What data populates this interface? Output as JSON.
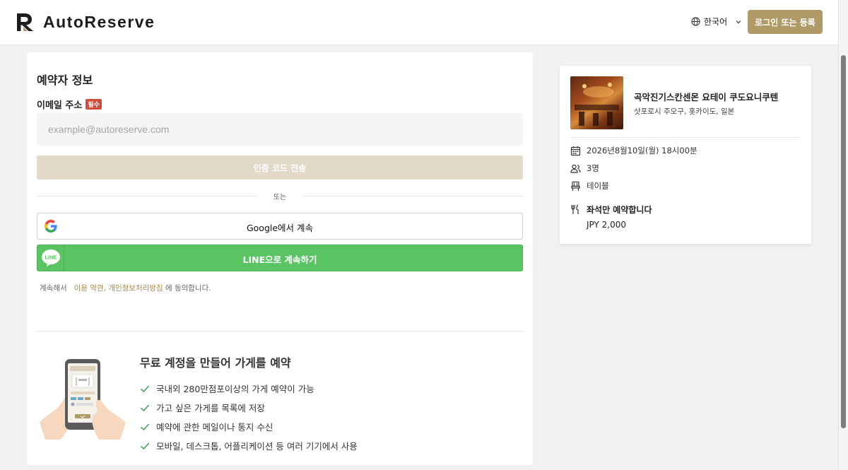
{
  "header": {
    "brand": "AutoReserve",
    "language": "한국어",
    "login_label": "로그인 또는 등록"
  },
  "form": {
    "section_title": "예약자 정보",
    "email_label": "이메일 주소",
    "required_badge": "필수",
    "email_placeholder": "example@autoreserve.com",
    "send_code_label": "인증 코드 전송",
    "or_text": "또는",
    "google_label": "Google에서 계속",
    "line_label": "LINE으로 계속하기",
    "terms_prefix": "계속해서",
    "terms_link1": "이용 약관",
    "terms_sep": ", ",
    "terms_link2": "개인정보처리방침",
    "terms_suffix": "에 동의합니다."
  },
  "promo": {
    "title": "무료 계정을 만들어 가게를 예약",
    "benefits": [
      "국내외 280만점포이상의 가게 예약이 가능",
      "가고 싶은 가게를 목록에 저장",
      "예약에 관한 메일이나 통지 수신",
      "모바일, 데스크톱, 어플리케이션 등 여러 기기에서 사용"
    ]
  },
  "reservation": {
    "restaurant_name": "곡악진기스칸센몬 요테이 쿠도요니쿠텐",
    "location": "삿포로시 주오구, 홋카이도, 일본",
    "datetime": "2026년8월10일(월) 18시00분",
    "party_size": "3명",
    "seat_type": "테이블",
    "plan": "좌석만 예약합니다",
    "price": "JPY 2,000"
  },
  "colors": {
    "brand_gold": "#b09a68",
    "disabled_gold": "#e2d9c8",
    "line_green": "#5ac463",
    "required_red": "#d44b3e",
    "check_green": "#3f9e56"
  }
}
